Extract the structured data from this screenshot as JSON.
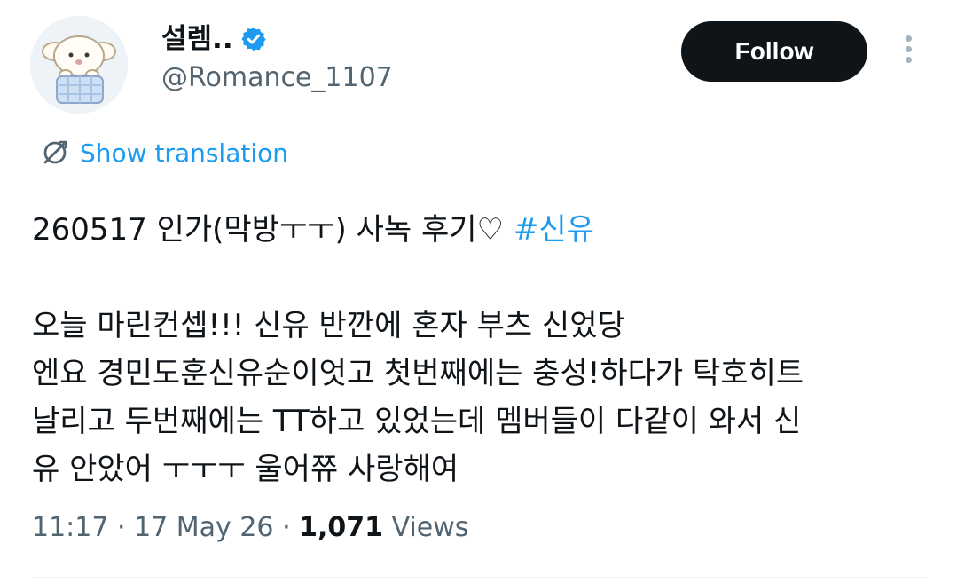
{
  "author": {
    "display_name": "설렘..",
    "handle": "@Romance_1107",
    "verified": true
  },
  "follow_button": {
    "label": "Follow"
  },
  "translation": {
    "label": "Show translation"
  },
  "tweet": {
    "line1_text": "260517 인가(막방ㅜㅜ) 사녹 후기♡ ",
    "line1_hashtag": "#신유",
    "line2": "오늘 마린컨셉!!! 신유 반깐에 혼자 부츠 신었당",
    "line3": "엔요 경민도훈신유순이엇고 첫번째에는 충성!하다가 탁호히트",
    "line4": "날리고 두번째에는 TT하고 있었는데 멤버들이 다같이 와서 신",
    "line5": "유 안았어 ㅜㅜㅜ 울어쮸 사랑해여"
  },
  "meta": {
    "time": "11:17",
    "sep1": " · ",
    "date": "17 May 26",
    "sep2": " · ",
    "views_count": "1,071",
    "views_label": " Views"
  },
  "colors": {
    "accent": "#1d9bf0",
    "text": "#0f1419",
    "muted": "#536471",
    "follow_bg": "#0f1419"
  },
  "icons": {
    "verified": "verified-badge-icon",
    "translate": "translate-icon",
    "more": "more-options-icon"
  }
}
